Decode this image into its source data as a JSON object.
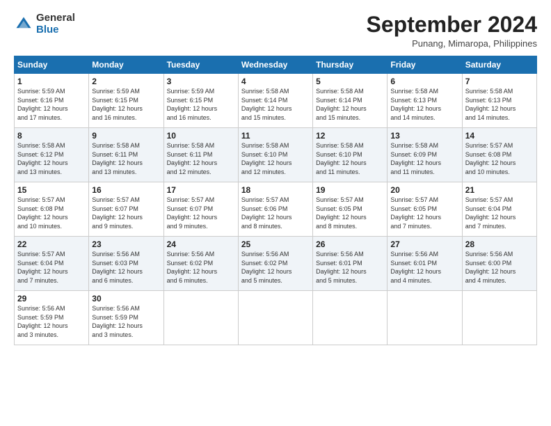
{
  "header": {
    "logo_general": "General",
    "logo_blue": "Blue",
    "month_title": "September 2024",
    "subtitle": "Punang, Mimaropa, Philippines"
  },
  "calendar": {
    "columns": [
      "Sunday",
      "Monday",
      "Tuesday",
      "Wednesday",
      "Thursday",
      "Friday",
      "Saturday"
    ],
    "weeks": [
      [
        {
          "day": "",
          "detail": ""
        },
        {
          "day": "2",
          "detail": "Sunrise: 5:59 AM\nSunset: 6:15 PM\nDaylight: 12 hours\nand 16 minutes."
        },
        {
          "day": "3",
          "detail": "Sunrise: 5:59 AM\nSunset: 6:15 PM\nDaylight: 12 hours\nand 16 minutes."
        },
        {
          "day": "4",
          "detail": "Sunrise: 5:58 AM\nSunset: 6:14 PM\nDaylight: 12 hours\nand 15 minutes."
        },
        {
          "day": "5",
          "detail": "Sunrise: 5:58 AM\nSunset: 6:14 PM\nDaylight: 12 hours\nand 15 minutes."
        },
        {
          "day": "6",
          "detail": "Sunrise: 5:58 AM\nSunset: 6:13 PM\nDaylight: 12 hours\nand 14 minutes."
        },
        {
          "day": "7",
          "detail": "Sunrise: 5:58 AM\nSunset: 6:13 PM\nDaylight: 12 hours\nand 14 minutes."
        }
      ],
      [
        {
          "day": "8",
          "detail": "Sunrise: 5:58 AM\nSunset: 6:12 PM\nDaylight: 12 hours\nand 13 minutes."
        },
        {
          "day": "9",
          "detail": "Sunrise: 5:58 AM\nSunset: 6:11 PM\nDaylight: 12 hours\nand 13 minutes."
        },
        {
          "day": "10",
          "detail": "Sunrise: 5:58 AM\nSunset: 6:11 PM\nDaylight: 12 hours\nand 12 minutes."
        },
        {
          "day": "11",
          "detail": "Sunrise: 5:58 AM\nSunset: 6:10 PM\nDaylight: 12 hours\nand 12 minutes."
        },
        {
          "day": "12",
          "detail": "Sunrise: 5:58 AM\nSunset: 6:10 PM\nDaylight: 12 hours\nand 11 minutes."
        },
        {
          "day": "13",
          "detail": "Sunrise: 5:58 AM\nSunset: 6:09 PM\nDaylight: 12 hours\nand 11 minutes."
        },
        {
          "day": "14",
          "detail": "Sunrise: 5:57 AM\nSunset: 6:08 PM\nDaylight: 12 hours\nand 10 minutes."
        }
      ],
      [
        {
          "day": "15",
          "detail": "Sunrise: 5:57 AM\nSunset: 6:08 PM\nDaylight: 12 hours\nand 10 minutes."
        },
        {
          "day": "16",
          "detail": "Sunrise: 5:57 AM\nSunset: 6:07 PM\nDaylight: 12 hours\nand 9 minutes."
        },
        {
          "day": "17",
          "detail": "Sunrise: 5:57 AM\nSunset: 6:07 PM\nDaylight: 12 hours\nand 9 minutes."
        },
        {
          "day": "18",
          "detail": "Sunrise: 5:57 AM\nSunset: 6:06 PM\nDaylight: 12 hours\nand 8 minutes."
        },
        {
          "day": "19",
          "detail": "Sunrise: 5:57 AM\nSunset: 6:05 PM\nDaylight: 12 hours\nand 8 minutes."
        },
        {
          "day": "20",
          "detail": "Sunrise: 5:57 AM\nSunset: 6:05 PM\nDaylight: 12 hours\nand 7 minutes."
        },
        {
          "day": "21",
          "detail": "Sunrise: 5:57 AM\nSunset: 6:04 PM\nDaylight: 12 hours\nand 7 minutes."
        }
      ],
      [
        {
          "day": "22",
          "detail": "Sunrise: 5:57 AM\nSunset: 6:04 PM\nDaylight: 12 hours\nand 7 minutes."
        },
        {
          "day": "23",
          "detail": "Sunrise: 5:56 AM\nSunset: 6:03 PM\nDaylight: 12 hours\nand 6 minutes."
        },
        {
          "day": "24",
          "detail": "Sunrise: 5:56 AM\nSunset: 6:02 PM\nDaylight: 12 hours\nand 6 minutes."
        },
        {
          "day": "25",
          "detail": "Sunrise: 5:56 AM\nSunset: 6:02 PM\nDaylight: 12 hours\nand 5 minutes."
        },
        {
          "day": "26",
          "detail": "Sunrise: 5:56 AM\nSunset: 6:01 PM\nDaylight: 12 hours\nand 5 minutes."
        },
        {
          "day": "27",
          "detail": "Sunrise: 5:56 AM\nSunset: 6:01 PM\nDaylight: 12 hours\nand 4 minutes."
        },
        {
          "day": "28",
          "detail": "Sunrise: 5:56 AM\nSunset: 6:00 PM\nDaylight: 12 hours\nand 4 minutes."
        }
      ],
      [
        {
          "day": "29",
          "detail": "Sunrise: 5:56 AM\nSunset: 5:59 PM\nDaylight: 12 hours\nand 3 minutes."
        },
        {
          "day": "30",
          "detail": "Sunrise: 5:56 AM\nSunset: 5:59 PM\nDaylight: 12 hours\nand 3 minutes."
        },
        {
          "day": "",
          "detail": ""
        },
        {
          "day": "",
          "detail": ""
        },
        {
          "day": "",
          "detail": ""
        },
        {
          "day": "",
          "detail": ""
        },
        {
          "day": "",
          "detail": ""
        }
      ]
    ],
    "week1_sun": {
      "day": "1",
      "detail": "Sunrise: 5:59 AM\nSunset: 6:16 PM\nDaylight: 12 hours\nand 17 minutes."
    }
  }
}
